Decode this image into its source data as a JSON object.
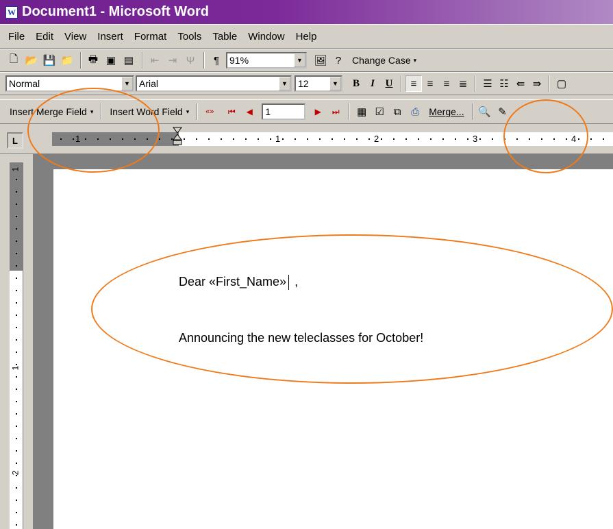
{
  "window": {
    "title": "Document1 - Microsoft Word",
    "app_icon_letter": "W"
  },
  "menu": [
    "File",
    "Edit",
    "View",
    "Insert",
    "Format",
    "Tools",
    "Table",
    "Window",
    "Help"
  ],
  "standard_toolbar": {
    "zoom_value": "91%",
    "change_case_label": "Change Case",
    "paragraph_mark": "¶"
  },
  "formatting_toolbar": {
    "style_value": "Normal",
    "font_value": "Arial",
    "size_value": "12",
    "bold": "B",
    "italic": "I",
    "underline": "U"
  },
  "mail_merge_toolbar": {
    "insert_merge_field_label": "Insert Merge Field",
    "insert_word_field_label": "Insert Word Field",
    "view_merged_data": "«»",
    "record_number": "1",
    "merge_label": "Merge..."
  },
  "ruler": {
    "tab_selector": "L",
    "h_numbers": [
      "1",
      "1",
      "2",
      "3",
      "4"
    ],
    "v_numbers": [
      "1",
      "1",
      "2"
    ]
  },
  "document": {
    "line1_prefix": "Dear ",
    "merge_field": "«First_Name»",
    "line1_suffix": " ,",
    "line2": "Announcing the new teleclasses for October!"
  },
  "annotation_color": "#f07a1a"
}
